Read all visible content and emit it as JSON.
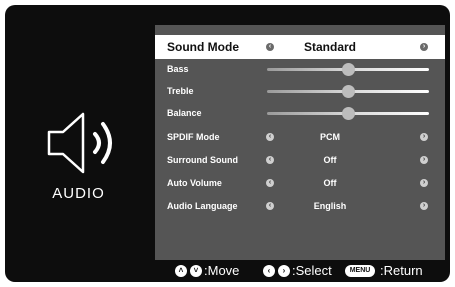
{
  "side": {
    "label": "AUDIO",
    "icon": "speaker-sound-icon"
  },
  "menu": {
    "title": {
      "label": "Sound Mode",
      "value": "Standard"
    },
    "sliders": [
      {
        "label": "Bass",
        "level": 0.5
      },
      {
        "label": "Treble",
        "level": 0.5
      },
      {
        "label": "Balance",
        "level": 0.5
      }
    ],
    "options": [
      {
        "label": "SPDIF Mode",
        "value": "PCM"
      },
      {
        "label": "Surround Sound",
        "value": "Off"
      },
      {
        "label": "Auto Volume",
        "value": "Off"
      },
      {
        "label": "Audio Language",
        "value": "English"
      }
    ]
  },
  "footer": {
    "move": ":Move",
    "select": ":Select",
    "menu_key": "MENU",
    "return": ":Return"
  },
  "colors": {
    "panel": "#555555",
    "frame": "#0d0d0d",
    "highlight": "#ffffff"
  }
}
